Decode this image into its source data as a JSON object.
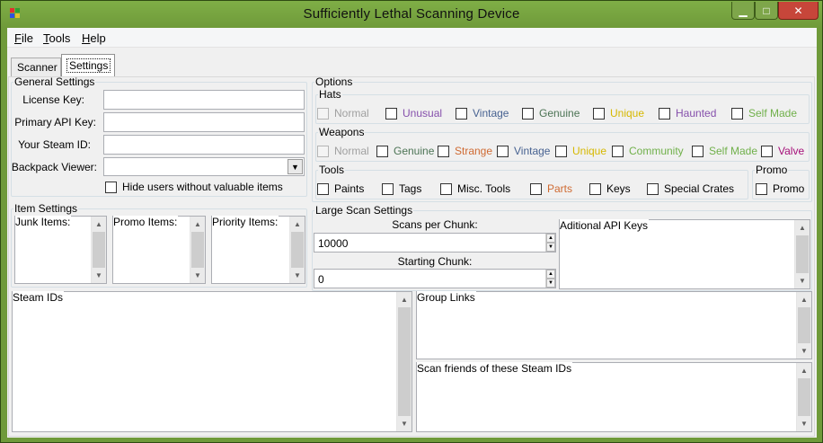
{
  "window": {
    "title": "Sufficiently Lethal Scanning Device",
    "controls": {
      "minimize": "▁",
      "maximize": "□",
      "close": "✕"
    }
  },
  "menu": [
    {
      "prefix": "",
      "hot": "F",
      "rest": "ile"
    },
    {
      "prefix": "",
      "hot": "T",
      "rest": "ools"
    },
    {
      "prefix": "",
      "hot": "H",
      "rest": "elp"
    }
  ],
  "tabs": {
    "scanner": "Scanner",
    "settings": "Settings"
  },
  "general": {
    "legend": "General Settings",
    "license_key_label": "License Key:",
    "license_key_value": "",
    "api_key_label": "Primary API Key:",
    "api_key_value": "",
    "steam_id_label": "Your Steam ID:",
    "steam_id_value": "",
    "backpack_label": "Backpack Viewer:",
    "backpack_value": "",
    "hide_users_label": "Hide users without valuable items"
  },
  "item_settings": {
    "legend": "Item Settings",
    "junk": "Junk Items:",
    "promo": "Promo Items:",
    "priority": "Priority Items:"
  },
  "options": {
    "legend": "Options",
    "hats_legend": "Hats",
    "hats": [
      {
        "label": "Normal",
        "color": "#a0a0a0"
      },
      {
        "label": "Unusual",
        "color": "#8650ac"
      },
      {
        "label": "Vintage",
        "color": "#476291"
      },
      {
        "label": "Genuine",
        "color": "#4d7455"
      },
      {
        "label": "Unique",
        "color": "#d6b800"
      },
      {
        "label": "Haunted",
        "color": "#8650ac"
      },
      {
        "label": "Self Made",
        "color": "#70b04a"
      }
    ],
    "weapons_legend": "Weapons",
    "weapons": [
      {
        "label": "Normal",
        "color": "#a0a0a0"
      },
      {
        "label": "Genuine",
        "color": "#4d7455"
      },
      {
        "label": "Strange",
        "color": "#cf6a32"
      },
      {
        "label": "Vintage",
        "color": "#476291"
      },
      {
        "label": "Unique",
        "color": "#d6b800"
      },
      {
        "label": "Community",
        "color": "#70b04a"
      },
      {
        "label": "Self Made",
        "color": "#70b04a"
      },
      {
        "label": "Valve",
        "color": "#a50f79"
      }
    ],
    "tools_legend": "Tools",
    "tools": [
      {
        "label": "Paints",
        "color": "#000000"
      },
      {
        "label": "Tags",
        "color": "#000000"
      },
      {
        "label": "Misc. Tools",
        "color": "#000000"
      },
      {
        "label": "Parts",
        "color": "#cf6a32"
      },
      {
        "label": "Keys",
        "color": "#000000"
      },
      {
        "label": "Special Crates",
        "color": "#000000"
      }
    ],
    "promo_legend": "Promo",
    "promo_label": "Promo"
  },
  "large_scan": {
    "legend": "Large Scan Settings",
    "scans_per_chunk_label": "Scans per Chunk:",
    "scans_per_chunk": "10000",
    "starting_chunk_label": "Starting Chunk:",
    "starting_chunk": "0",
    "additional_api_keys": "Aditional API Keys"
  },
  "bottom": {
    "steam_ids": "Steam IDs",
    "group_links": "Group Links",
    "scan_friends": "Scan friends of these Steam IDs"
  }
}
